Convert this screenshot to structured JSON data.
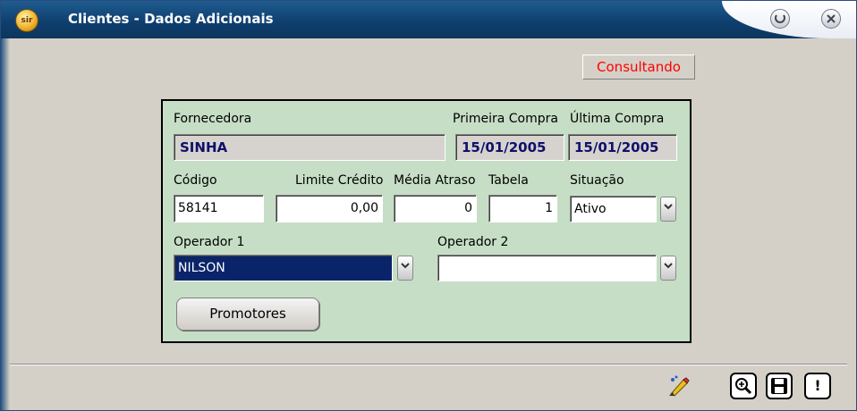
{
  "window": {
    "title": "Clientes - Dados Adicionais",
    "app_icon": "sir"
  },
  "status": {
    "text": "Consultando"
  },
  "form": {
    "fornecedora_label": "Fornecedora",
    "fornecedora_value": "SINHA",
    "primeira_compra_label": "Primeira Compra",
    "primeira_compra_value": "15/01/2005",
    "ultima_compra_label": "Última Compra",
    "ultima_compra_value": "15/01/2005",
    "codigo_label": "Código",
    "codigo_value": "58141",
    "limite_credito_label": "Limite Crédito",
    "limite_credito_value": "0,00",
    "media_atraso_label": "Média Atraso",
    "media_atraso_value": "0",
    "tabela_label": "Tabela",
    "tabela_value": "1",
    "situacao_label": "Situação",
    "situacao_value": "Ativo",
    "operador1_label": "Operador 1",
    "operador1_value": "NILSON",
    "operador2_label": "Operador 2",
    "operador2_value": "",
    "promotores_button": "Promotores"
  },
  "toolbar": {
    "icons": [
      "edit-clear-icon",
      "zoom-in-icon",
      "save-icon",
      "alert-icon"
    ],
    "alert_glyph": "!"
  },
  "colors": {
    "panel_bg": "#c6dec6",
    "selected_bg": "#0a246a",
    "status_text": "#ff0000"
  }
}
